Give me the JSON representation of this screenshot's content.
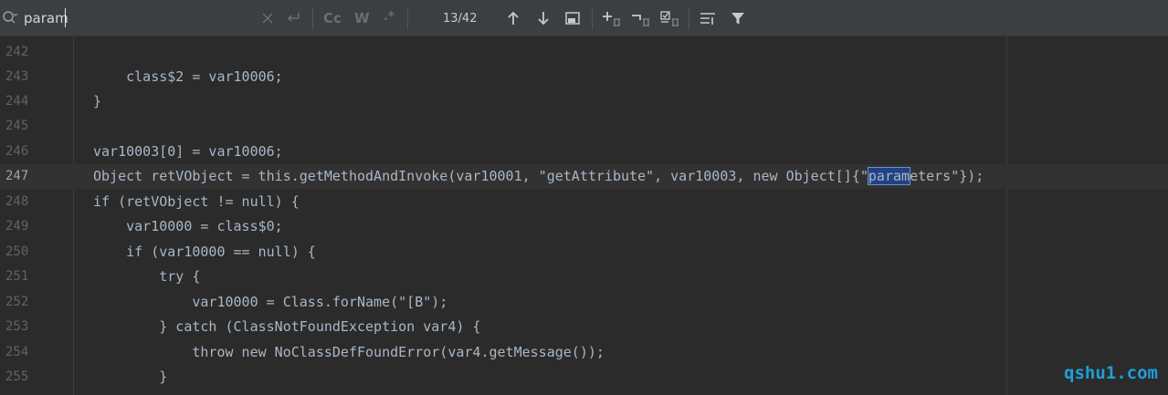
{
  "search": {
    "query": "param",
    "match_count": "13/42",
    "options": {
      "match_case": "Cc",
      "words": "W",
      "regex": ".*"
    }
  },
  "icons": {
    "search": "search-history-icon",
    "clear": "clear-icon",
    "newline": "newline-icon",
    "prev": "arrow-up-icon",
    "next": "arrow-down-icon",
    "filter": "filter-icon"
  },
  "editor": {
    "highlighted_match": "param",
    "lines": [
      {
        "num": "242",
        "code": ""
      },
      {
        "num": "243",
        "code": "    class$2 = var10006;"
      },
      {
        "num": "244",
        "code": "}"
      },
      {
        "num": "245",
        "code": ""
      },
      {
        "num": "246",
        "code": "var10003[0] = var10006;"
      },
      {
        "num": "247",
        "code_before": "Object retVObject = this.getMethodAndInvoke(var10001, \"getAttribute\", var10003, new Object[]{\"",
        "code_match": "param",
        "code_after": "eters\"});",
        "current": true
      },
      {
        "num": "248",
        "code": "if (retVObject != null) {"
      },
      {
        "num": "249",
        "code": "    var10000 = class$0;"
      },
      {
        "num": "250",
        "code": "    if (var10000 == null) {"
      },
      {
        "num": "251",
        "code": "        try {"
      },
      {
        "num": "252",
        "code": "            var10000 = Class.forName(\"[B\");"
      },
      {
        "num": "253",
        "code": "        } catch (ClassNotFoundException var4) {"
      },
      {
        "num": "254",
        "code": "            throw new NoClassDefFoundError(var4.getMessage());"
      },
      {
        "num": "255",
        "code": "        }"
      }
    ]
  },
  "watermark": "qshu1.com",
  "colors": {
    "highlight": "#214283",
    "code": "#a9b7c6",
    "background": "#2b2b2b",
    "watermark": "#1e9fd8"
  }
}
